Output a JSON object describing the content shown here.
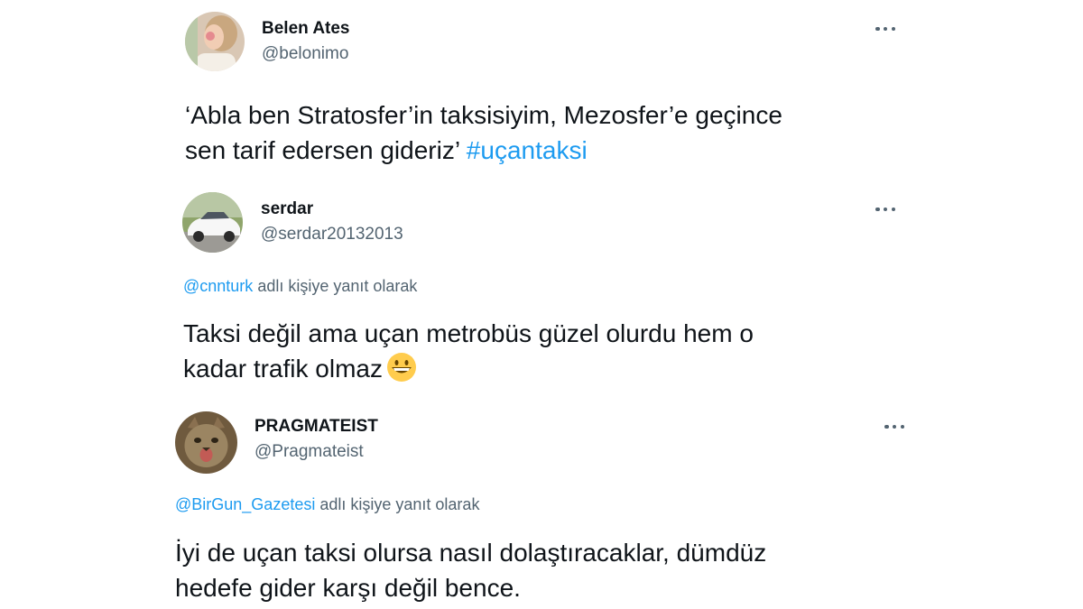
{
  "tweets": [
    {
      "name": "Belen Ates",
      "handle": "@belonimo",
      "more_icon": "ellipsis-icon",
      "text_line1": "‘Abla ben Stratosfer’in taksisiyim, Mezosfer’e geçince",
      "text_line2": "sen tarif edersen gideriz’",
      "hashtag": "#uçantaksi"
    },
    {
      "name": "serdar",
      "handle": "@serdar20132013",
      "more_icon": "ellipsis-icon",
      "reply_to": "@cnnturk",
      "reply_suffix": "adlı kişiye yanıt olarak",
      "text_line1": "Taksi değil ama uçan metrobüs güzel olurdu hem o",
      "text_line2": "kadar trafik olmaz",
      "emoji": "grinning-face-emoji"
    },
    {
      "name": "PRAGMATEIST",
      "handle": "@Pragmateist",
      "more_icon": "ellipsis-icon",
      "reply_to": "@BirGun_Gazetesi",
      "reply_suffix": "adlı kişiye yanıt olarak",
      "text_line1": "İyi de uçan taksi olursa nasıl dolaştıracaklar, dümdüz",
      "text_line2": "hedefe gider karşı değil bence."
    }
  ],
  "colors": {
    "text": "#0f1419",
    "secondary": "#536471",
    "link": "#1d9bf0",
    "background": "#ffffff"
  }
}
